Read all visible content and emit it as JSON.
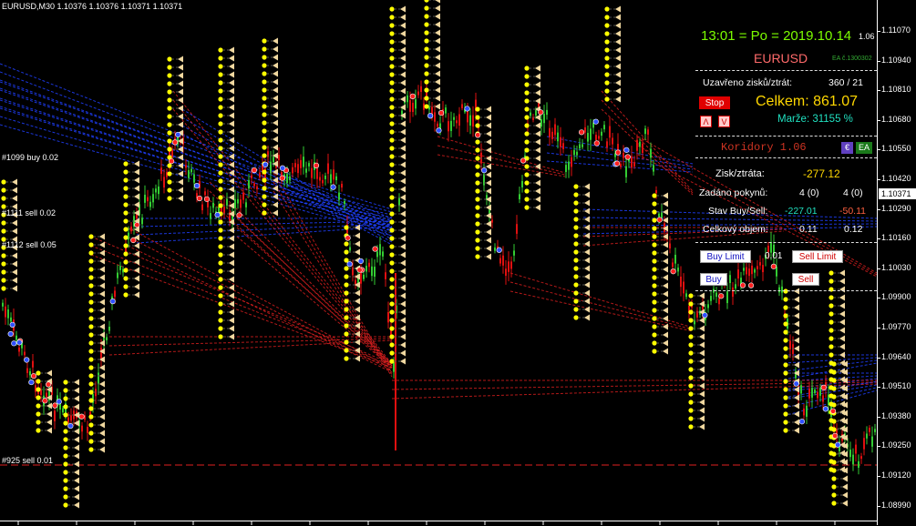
{
  "chart": {
    "symbol_title": "EURUSD,M30  1.10376 1.10376 1.10371 1.10371",
    "current_price_label": "1.10371",
    "order_labels": [
      "#1099 buy 0.02",
      "#1111 sell 0.02",
      "#1112 sell 0.05",
      "#925 sell 0.01"
    ],
    "price_ticks": [
      "1.11070",
      "1.10940",
      "1.10810",
      "1.10680",
      "1.10550",
      "1.10420",
      "1.10290",
      "1.10160",
      "1.10030",
      "1.09900",
      "1.09770",
      "1.09640",
      "1.09510",
      "1.09380",
      "1.09250",
      "1.09120",
      "1.08990"
    ],
    "colors": {
      "bull": "#33cc33",
      "bear": "#e01010",
      "arrow_marker": "#ffff00",
      "arrow_triangle": "#f0d8a0",
      "blue_line": "#2040ff",
      "red_line": "#e02020",
      "buy_marker": "#3050ff",
      "sell_marker": "#ff2020"
    }
  },
  "panel": {
    "time": "13:01 = Po = 2019.10.14",
    "version": "1.06",
    "symbol": "EURUSD",
    "ea_id": "EA č.1300302",
    "closed_label": "Uzavřeno zisků/ztrát:",
    "closed_value": "360 / 21",
    "stop_label": "Stop",
    "total_label": "Celkem: 861.07",
    "arrow_up": "Λ",
    "arrow_down": "V",
    "margin_label": "Marže:  31155 %",
    "korridory": "Koridory 1.06",
    "euro_badge": "€",
    "ea_badge": "EA",
    "profit_label": "Zisk/ztráta:",
    "profit_value": "-277.12",
    "orders_label": "Zadáno pokynů:",
    "orders_buy": "4 (0)",
    "orders_sell": "4 (0)",
    "state_label": "Stav Buy/Sell:",
    "state_buy": "-227.01",
    "state_sell": "-50.11",
    "volume_label": "Celkový objem:",
    "volume_buy": "0.11",
    "volume_sell": "0.12",
    "buy_limit_label": "Buy Limit",
    "lot_value": "0.01",
    "sell_limit_label": "Sell Limit",
    "buy_label": "Buy",
    "sell_label": "Sell",
    "colors": {
      "time": "#7cfc00",
      "symbol": "#ff6a6a",
      "total": "#ffd700",
      "margin": "#20e0c0",
      "profit": "#ffd700",
      "state_buy": "#20e0c0",
      "state_sell": "#ff6040",
      "korridory": "#cc3322"
    }
  }
}
